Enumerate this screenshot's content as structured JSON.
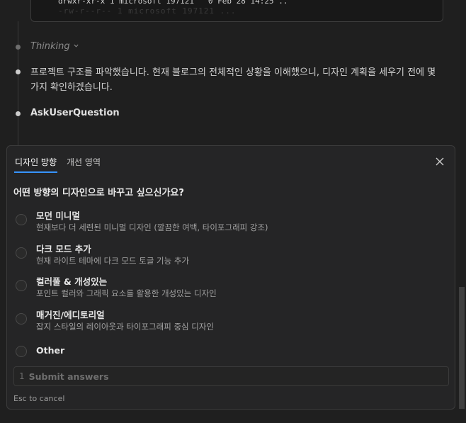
{
  "terminal": {
    "line": "drwxr-xr-x 1 microsoft 197121   0 Feb 28 14:25 ..",
    "ghost_line": "-rw-r--r-- 1 microsoft 197121 ..."
  },
  "thread": {
    "thinking_label": "Thinking",
    "message": "프로젝트 구조를 파악했습니다. 현재 블로그의 전체적인 상황을 이해했으니, 디자인 계획을 세우기 전에 몇 가지 확인하겠습니다.",
    "tool_name": "AskUserQuestion"
  },
  "panel": {
    "tabs": [
      {
        "label": "디자인 방향",
        "active": true
      },
      {
        "label": "개선 영역",
        "active": false
      }
    ],
    "question": "어떤 방향의 디자인으로 바꾸고 싶으신가요?",
    "options": [
      {
        "label": "모던 미니멀",
        "description": "현재보다 더 세련된 미니멀 디자인 (깔끔한 여백, 타이포그래피 강조)"
      },
      {
        "label": "다크 모드 추가",
        "description": "현재 라이트 테마에 다크 모드 토글 기능 추가"
      },
      {
        "label": "컬러풀 & 개성있는",
        "description": "포인트 컬러와 그래픽 요소를 활용한 개성있는 디자인"
      },
      {
        "label": "매거진/에디토리얼",
        "description": "잡지 스타일의 레이아웃과 타이포그래피 중심 디자인"
      },
      {
        "label": "Other",
        "description": ""
      }
    ],
    "submit": {
      "count": "1",
      "label": "Submit answers"
    },
    "esc_hint": "Esc to cancel"
  },
  "icons": {
    "close": "close-icon",
    "chevron": "chevron-down-icon"
  },
  "colors": {
    "background": "#1f1f1f",
    "panel": "#252526",
    "accent": "#3794ff"
  }
}
